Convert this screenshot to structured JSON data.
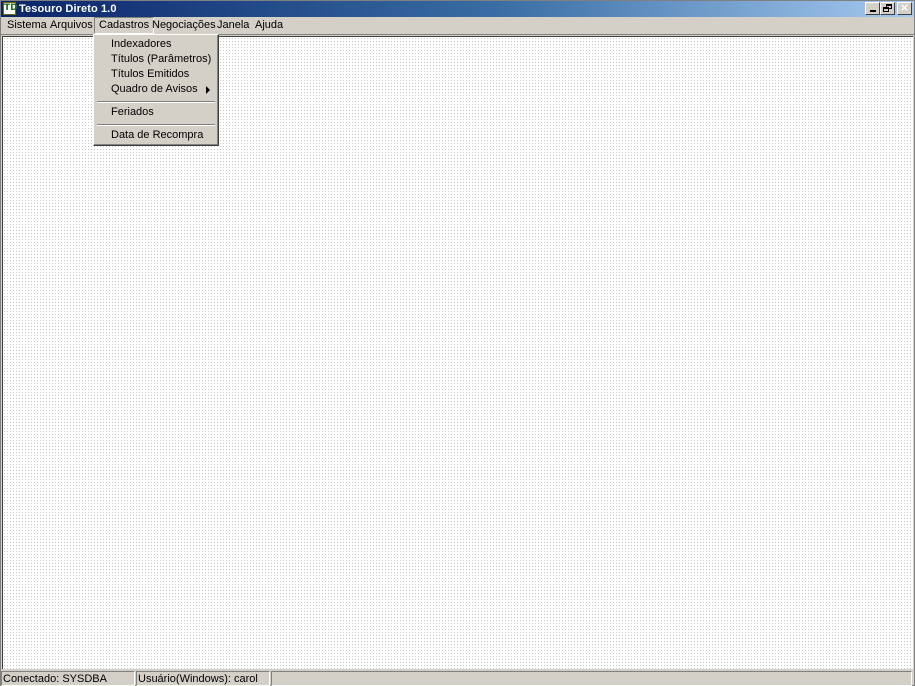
{
  "window": {
    "title": "Tesouro Direto 1.0",
    "icon_name": "app-icon",
    "icon_glyph": "TD"
  },
  "caption_buttons": {
    "minimize_icon": "minimize-icon",
    "restore_icon": "restore-icon",
    "close_icon": "close-icon",
    "close_glyph": "×"
  },
  "menubar": {
    "items": [
      {
        "label": "Sistema"
      },
      {
        "label": "Arquivos"
      },
      {
        "label": "Cadastros"
      },
      {
        "label": "Negociações"
      },
      {
        "label": "Janela"
      },
      {
        "label": "Ajuda"
      }
    ],
    "active_index": 2
  },
  "dropdown": {
    "items": [
      {
        "label": "Indexadores"
      },
      {
        "label": "Títulos (Parâmetros)"
      },
      {
        "label": "Títulos Emitidos"
      },
      {
        "label": "Quadro de Avisos",
        "has_submenu": true
      },
      {
        "label": "Feriados"
      },
      {
        "label": "Data de Recompra"
      }
    ]
  },
  "statusbar": {
    "connected": "Conectado: SYSDBA",
    "user": "Usuário(Windows): carol",
    "extra": ""
  },
  "colors": {
    "title_gradient_start": "#0a246a",
    "title_gradient_end": "#a6caf0",
    "face": "#d4d0c8"
  }
}
